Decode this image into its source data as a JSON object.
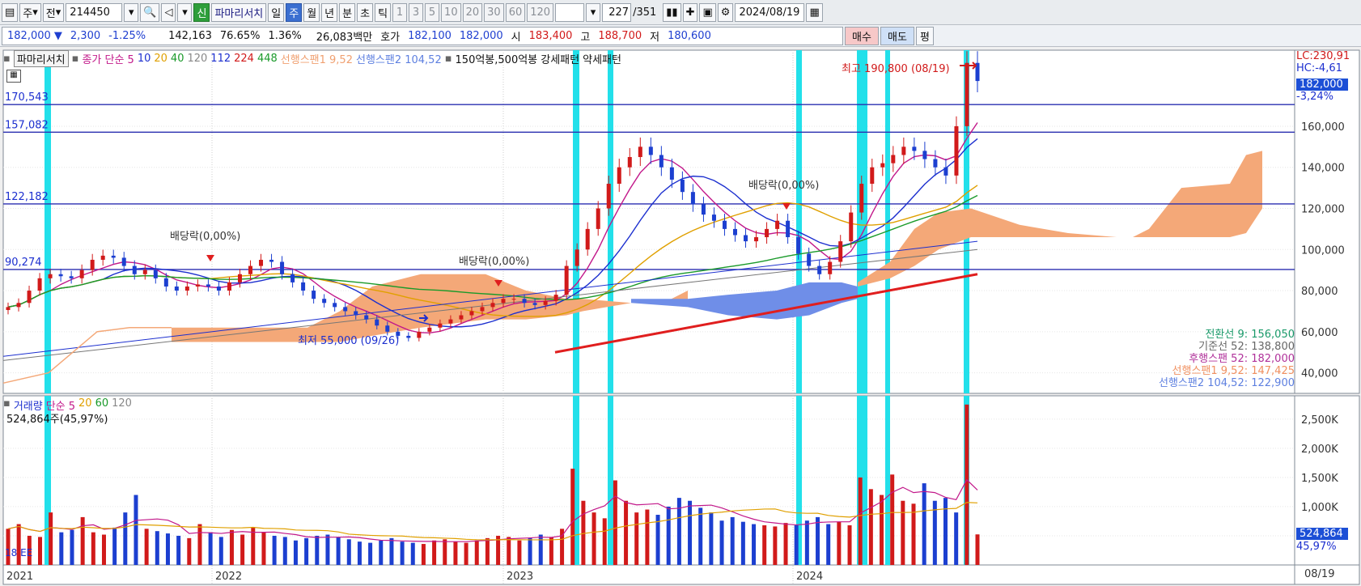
{
  "toolbar": {
    "mode": "주",
    "prev": "전",
    "code": "214450",
    "new_badge": "신",
    "stock_name": "파마리서치",
    "periods": [
      "일",
      "주",
      "월",
      "년"
    ],
    "selected_period": "주",
    "intraday": [
      "분",
      "초",
      "틱"
    ],
    "ticks": [
      "1",
      "3",
      "5",
      "10",
      "20",
      "30",
      "60",
      "120"
    ],
    "count": "227",
    "total": "/351",
    "date": "2024/08/19"
  },
  "quote": {
    "price": "182,000",
    "arrow": "▼",
    "change": "2,300",
    "change_pct": "-1.25%",
    "volume": "142,163",
    "vol_ratio": "76.65%",
    "turnover_pct": "1.36%",
    "amount": "26,083백만",
    "bid_label": "호가",
    "bid": "182,100",
    "ask": "182,000",
    "open_label": "시",
    "open": "183,400",
    "high_label": "고",
    "high": "188,700",
    "low_label": "저",
    "low": "180,600",
    "buy": "매수",
    "sell": "매도",
    "eval": "평"
  },
  "legend": {
    "name": "파마리서치",
    "ma_label": "종가 단순 5",
    "ma": [
      "10",
      "20",
      "40",
      "120",
      "112",
      "224",
      "448"
    ],
    "span1": "선행스팬1 9,52",
    "span2": "선행스팬2 104,52",
    "pattern": "150억봉,500억봉 강세패턴",
    "weak": "약세패턴"
  },
  "vol_legend": {
    "label": "거래량",
    "ma_label": "단순 5",
    "ma": [
      "20",
      "60",
      "120"
    ],
    "value": "524,864주(45,97%)"
  },
  "levels": [
    {
      "label": "170,543",
      "value": 170543
    },
    {
      "label": "157,082",
      "value": 157082
    },
    {
      "label": "122,182",
      "value": 122182
    },
    {
      "label": "90,274",
      "value": 90274
    }
  ],
  "annotations": {
    "high": "최고 190,800 (08/19)",
    "low": "최저 55,000 (09/26)",
    "dividend1": "배당락(0,00%)",
    "dividend2": "배당락(0,00%)",
    "dividend3": "배당락(0,00%)"
  },
  "right_axis": {
    "lc": "LC:230,91",
    "hc": "HC:-4,61",
    "price_tag": "182,000",
    "pct_tag": "-3,24%",
    "vol_tag": "524,864",
    "vol_pct": "45,97%",
    "date_tag": "08/19"
  },
  "ichimoku": {
    "conv": "전환선 9: 156,050",
    "base": "기준선 52: 138,800",
    "lag": "후행스팬 52: 182,000",
    "span1": "선행스팬1 9,52: 147,425",
    "span2": "선행스팬2 104,52: 122,900"
  },
  "vol_min_label": "18 EE",
  "chart_data": {
    "type": "candlestick",
    "x_labels": [
      "2021",
      "2022",
      "2023",
      "2024"
    ],
    "y_ticks": [
      40000,
      60000,
      80000,
      100000,
      120000,
      140000,
      160000
    ],
    "y_tick_labels": [
      "40,000",
      "60,000",
      "80,000",
      "100,000",
      "120,000",
      "140,000",
      "160,000"
    ],
    "ylim": [
      30000,
      197000
    ],
    "vol_ticks": [
      500000,
      1000000,
      1500000,
      2000000,
      2500000
    ],
    "vol_tick_labels": [
      "500K",
      "1,000K",
      "1,500K",
      "2,000K",
      "2,500K"
    ],
    "vol_ylim": [
      0,
      2900000
    ],
    "close_weekly_approx": [
      72000,
      74000,
      80000,
      86000,
      88000,
      87000,
      86000,
      90000,
      95000,
      97000,
      96000,
      92000,
      88000,
      90000,
      86000,
      82000,
      80000,
      82000,
      83000,
      82000,
      80000,
      84000,
      88000,
      92000,
      95000,
      94000,
      88000,
      84000,
      80000,
      76000,
      74000,
      72000,
      70000,
      68000,
      66000,
      63000,
      60000,
      58000,
      57000,
      60000,
      62000,
      64000,
      66000,
      68000,
      70000,
      72000,
      74000,
      76000,
      76000,
      74000,
      73000,
      75000,
      78000,
      92000,
      100000,
      110000,
      120000,
      132000,
      140000,
      145000,
      150000,
      146000,
      140000,
      134000,
      128000,
      122000,
      117000,
      114000,
      110000,
      107000,
      104000,
      106000,
      110000,
      114000,
      106000,
      98000,
      92000,
      88000,
      94000,
      104000,
      118000,
      132000,
      140000,
      142000,
      146000,
      150000,
      148000,
      144000,
      140000,
      136000,
      160000,
      190800,
      182000
    ],
    "volume_weekly_k_approx": [
      620,
      700,
      500,
      480,
      900,
      560,
      600,
      820,
      560,
      520,
      640,
      900,
      1200,
      620,
      580,
      540,
      500,
      460,
      700,
      560,
      480,
      600,
      520,
      640,
      560,
      500,
      480,
      420,
      460,
      500,
      520,
      480,
      440,
      400,
      380,
      420,
      460,
      400,
      380,
      360,
      420,
      440,
      400,
      380,
      420,
      460,
      500,
      480,
      420,
      460,
      520,
      480,
      620,
      1650,
      1100,
      900,
      800,
      1450,
      1100,
      900,
      950,
      860,
      1000,
      1150,
      1100,
      980,
      900,
      760,
      820,
      740,
      700,
      680,
      660,
      720,
      680,
      760,
      820,
      700,
      740,
      680,
      1500,
      1300,
      1200,
      1550,
      1100,
      1050,
      1400,
      1100,
      1150,
      900,
      2750,
      524
    ],
    "levels": [
      170543,
      157082,
      122182,
      90274
    ]
  }
}
